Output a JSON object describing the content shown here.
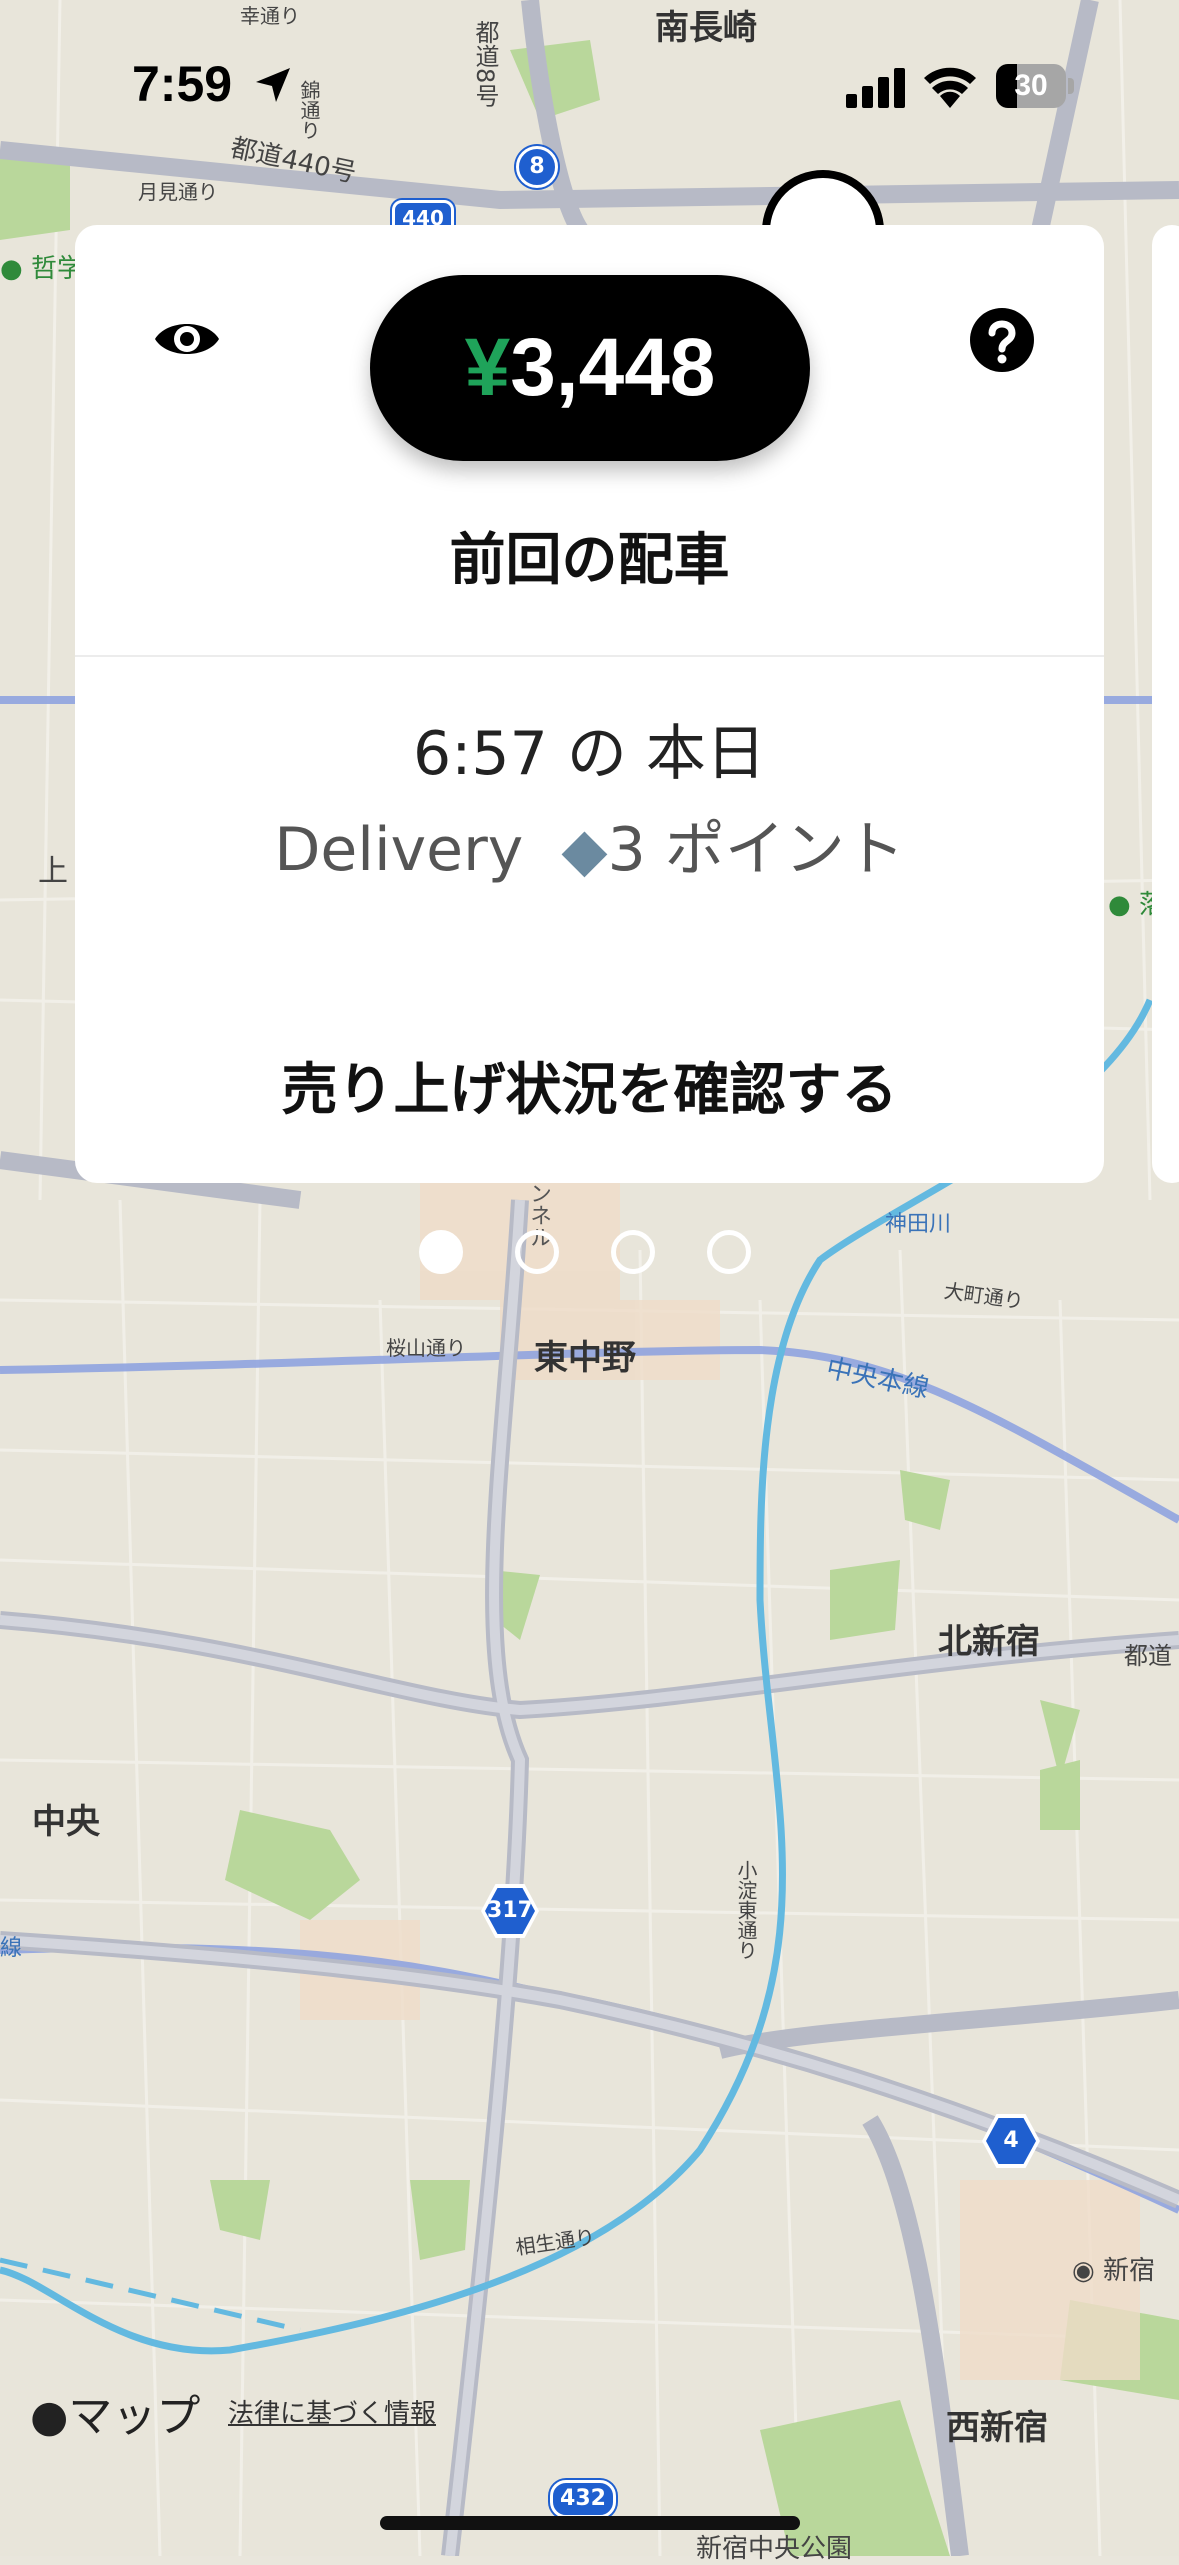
{
  "status_bar": {
    "time": "7:59",
    "battery": "30",
    "battery_fraction": 0.3
  },
  "card": {
    "earnings_currency": "¥",
    "earnings_amount": "3,448",
    "title": "前回の配車",
    "trip_time": "6:57 の 本日",
    "trip_type": "Delivery",
    "diamond": "◆",
    "trip_points": "3 ポイント",
    "link": "売り上げ状況を確認する"
  },
  "pager": {
    "count": 4,
    "active_index": 0
  },
  "map": {
    "labels": {
      "minaminagasaki": "南長崎",
      "saiwai_dori": "幸通り",
      "tokyo_pref_road_8": "都道8号",
      "nishiki_dori": "錦通り",
      "tokyo_road_440": "都道440号",
      "tsukimi_dori": "月見通り",
      "tetsugaku": "哲学",
      "ue": "上",
      "ochiai": "落",
      "kandagawa": "神田川",
      "omachi_dori": "大町通り",
      "sakurayama_dori": "桜山通り",
      "higashinakano": "東中野",
      "chuo_line": "中央本線",
      "tunnel": "トンネル",
      "kitashinjuku": "北新宿",
      "tokyo_road_edge": "都道",
      "chuo": "中央",
      "sen": "線",
      "koyodo_dori": "小淀東通り",
      "aioi_dori": "相生通り",
      "shinjuku_edge": "新宿",
      "nishishinjuku": "西新宿",
      "shinjuku_chuo_park": "新宿中央公園"
    },
    "route_shields": {
      "r8": "8",
      "r440": "440",
      "r317": "317",
      "r4": "4",
      "r432": "432"
    },
    "logo_text": "マップ",
    "legal_text": "法律に基づく情報"
  },
  "colors": {
    "earnings_green": "#1fa35a",
    "river_blue": "#5fb8e0",
    "rail_blue": "#7d95d8",
    "park_green": "#9ccc7a"
  }
}
